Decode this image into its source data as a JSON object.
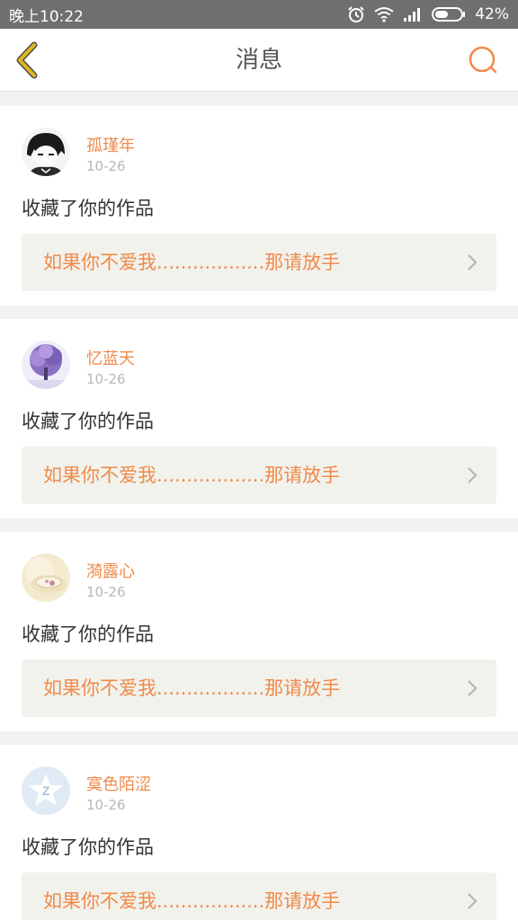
{
  "status_bar": {
    "time": "晚上10:22",
    "battery": "42%",
    "icons": [
      "alarm-icon",
      "wifi-icon",
      "signal-icon",
      "battery-icon"
    ]
  },
  "header": {
    "title": "消息",
    "back_icon": "chevron-left-icon",
    "search_icon": "search-icon"
  },
  "colors": {
    "accent": "#f08a4b",
    "back_arrow": "#e2b71f",
    "work_box_bg": "#f2f2ec"
  },
  "messages": [
    {
      "username": "孤瑾年",
      "date": "10-26",
      "action": "收藏了你的作品",
      "work_title": "如果你不爱我..................那请放手"
    },
    {
      "username": "忆蓝天",
      "date": "10-26",
      "action": "收藏了你的作品",
      "work_title": "如果你不爱我..................那请放手"
    },
    {
      "username": "漪露心",
      "date": "10-26",
      "action": "收藏了你的作品",
      "work_title": "如果你不爱我..................那请放手"
    },
    {
      "username": "寞色陌涩",
      "date": "10-26",
      "action": "收藏了你的作品",
      "work_title": "如果你不爱我..................那请放手"
    }
  ]
}
